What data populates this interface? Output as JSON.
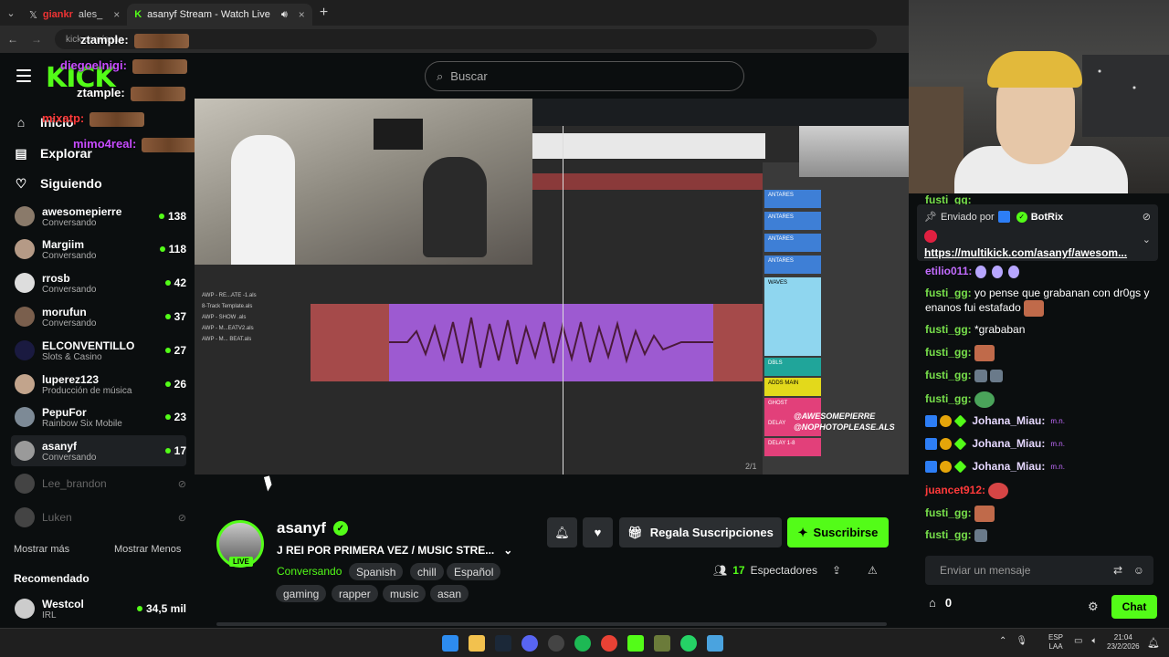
{
  "browser": {
    "tabs": [
      {
        "title": "giankr",
        "sub": "ales_"
      },
      {
        "title": "asanyf Stream - Watch Live",
        "active": true
      }
    ],
    "url": "kick.com/asan"
  },
  "overlay_chat": [
    {
      "user": "diegoelnigi:"
    },
    {
      "user": "ztample:"
    },
    {
      "user": "mixatp:"
    },
    {
      "user": "mimo4real:"
    },
    {
      "user": "ztample:"
    }
  ],
  "header": {
    "logo": "KICK",
    "search_placeholder": "Buscar"
  },
  "sidebar": {
    "nav": [
      {
        "label": "Inicio",
        "icon": "home-icon"
      },
      {
        "label": "Explorar",
        "icon": "compass-icon"
      },
      {
        "label": "Siguiendo",
        "icon": "heart-icon"
      }
    ],
    "channels": [
      {
        "name": "awesomepierre",
        "category": "Conversando",
        "viewers": "138"
      },
      {
        "name": "Margiim",
        "category": "Conversando",
        "viewers": "118"
      },
      {
        "name": "rrosb",
        "category": "Conversando",
        "viewers": "42"
      },
      {
        "name": "morufun",
        "category": "Conversando",
        "viewers": "37"
      },
      {
        "name": "ELCONVENTILLO",
        "category": "Slots & Casino",
        "viewers": "27"
      },
      {
        "name": "luperez123",
        "category": "Producción de música",
        "viewers": "26"
      },
      {
        "name": "PepuFor",
        "category": "Rainbow Six Mobile",
        "viewers": "23"
      },
      {
        "name": "asanyf",
        "category": "Conversando",
        "viewers": "17"
      }
    ],
    "offline": [
      "Lee_brandon",
      "Luken"
    ],
    "show_more": "Mostrar más",
    "show_less": "Mostrar Menos",
    "recommended_title": "Recomendado",
    "recommended": [
      {
        "name": "Westcol",
        "category": "IRL",
        "viewers": "34,5 mil"
      }
    ]
  },
  "video": {
    "watermark_line1": "@AWESOMEPIERRE",
    "watermark_line2": "@NOPHOTOPLEASE.ALS",
    "page": "2/1",
    "tracks": [
      "ANTARES",
      "ANTARES",
      "ANTARES",
      "ANTARES",
      "WAVES",
      "DBLS",
      "ADDS MAIN",
      "GHOST",
      "DELAY",
      "DELAY 1-8"
    ],
    "files": [
      "AWP - RE...ATE -1.als",
      "8-Track Template.als",
      "AWP - SHOW .als",
      "AWP - M...EATV2.als",
      "AWP - M... BEAT.als"
    ]
  },
  "stream": {
    "name": "asanyf",
    "live_label": "LIVE",
    "title": "J REI POR PRIMERA VEZ / MUSIC STRE...",
    "category": "Conversando",
    "tags": [
      "Spanish",
      "chill",
      "Español",
      "gaming",
      "rapper",
      "music",
      "asan"
    ],
    "gift_label": "Regala Suscripciones",
    "subscribe_label": "Suscribirse",
    "viewer_count": "17",
    "viewer_label": "Espectadores"
  },
  "chat": {
    "pinned": {
      "prefix": "Enviado por",
      "user": "BotRix",
      "link": "https://multikick.com/asanyf/awesom..."
    },
    "messages": [
      {
        "user": "fusti_gg:",
        "text": ""
      },
      {
        "user": "etilio011:",
        "text": ""
      },
      {
        "user": "fusti_gg:",
        "text": "yo pense que grabanan con dr0gs y enanos fui estafado"
      },
      {
        "user": "fusti_gg:",
        "text": "*grababan"
      },
      {
        "user": "fusti_gg:",
        "text": ""
      },
      {
        "user": "fusti_gg:",
        "text": ""
      },
      {
        "user": "fusti_gg:",
        "text": ""
      },
      {
        "user": "Johana_Miau:",
        "text": "m.n."
      },
      {
        "user": "Johana_Miau:",
        "text": "m.n."
      },
      {
        "user": "Johana_Miau:",
        "text": "m.n."
      },
      {
        "user": "juancet912:",
        "text": ""
      },
      {
        "user": "fusti_gg:",
        "text": ""
      },
      {
        "user": "fusti_gg:",
        "text": ""
      }
    ],
    "input_placeholder": "Enviar un mensaje",
    "points": "0",
    "chat_button": "Chat"
  },
  "taskbar": {
    "lang1": "ESP",
    "lang2": "LAA",
    "time": "21:04",
    "date": "23/2/2026"
  },
  "colors": {
    "accent": "#53fc18",
    "background": "#0b0e0f",
    "panel": "#1e2124"
  }
}
